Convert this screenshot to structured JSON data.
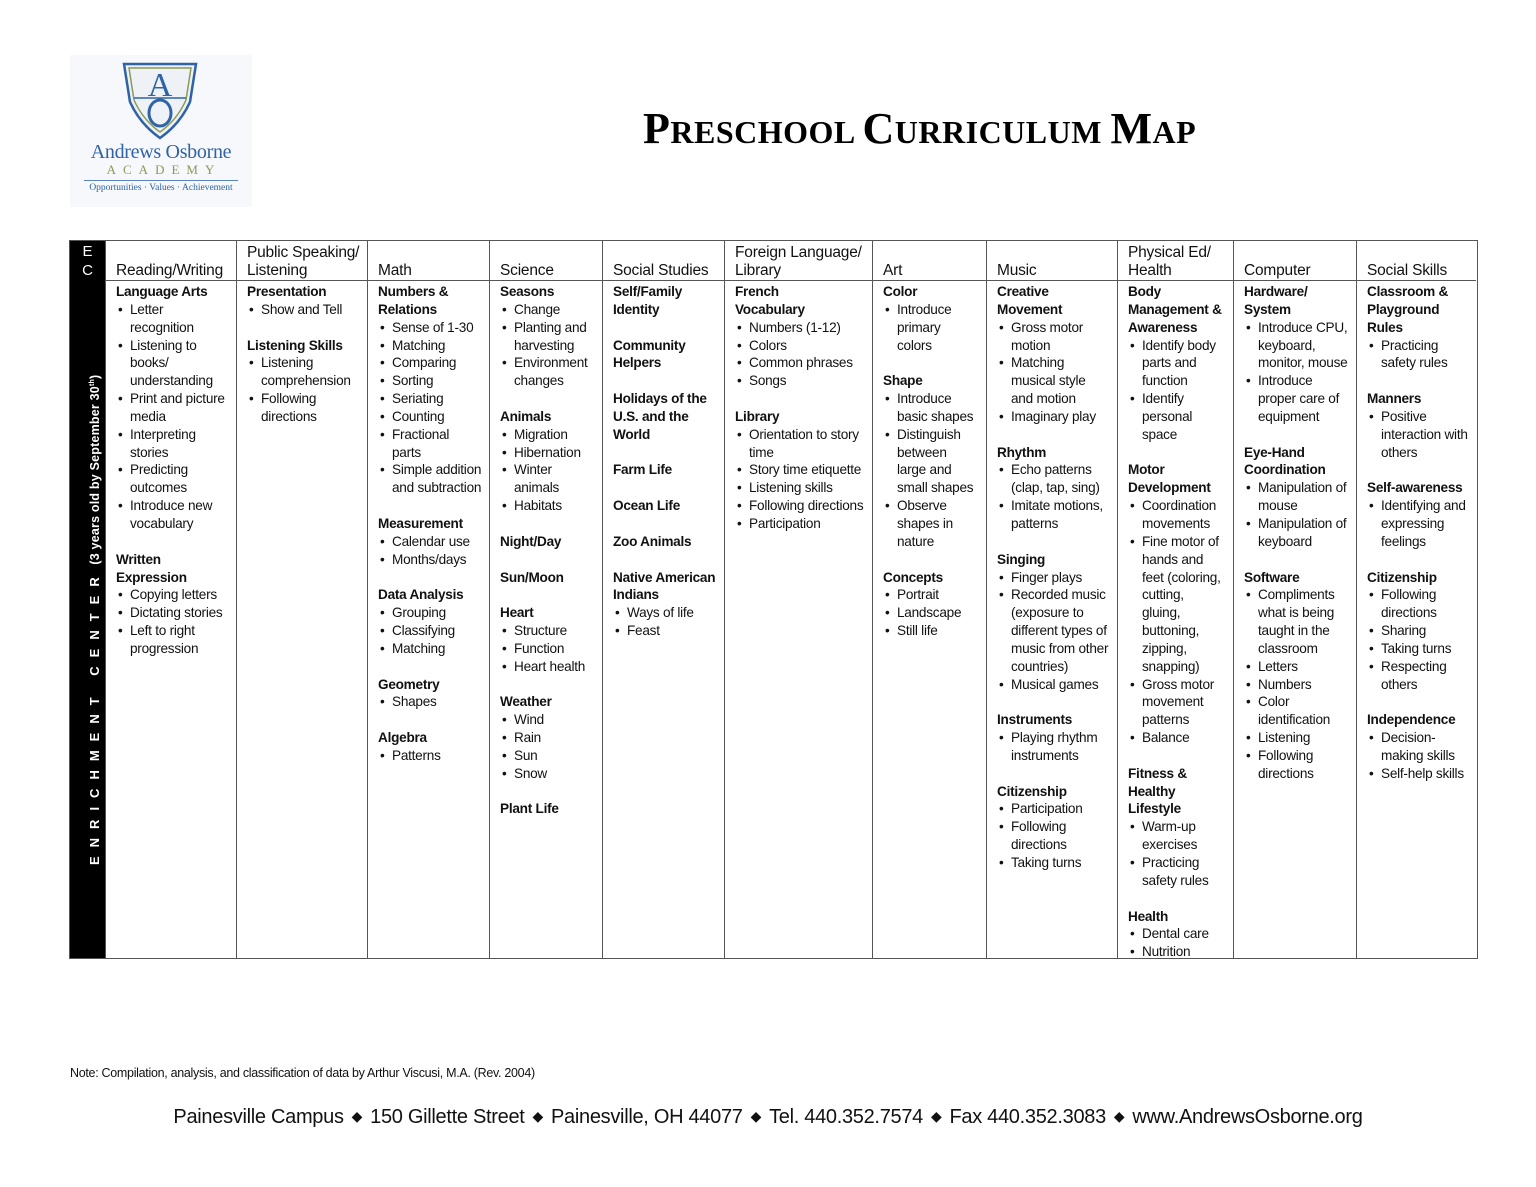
{
  "logo": {
    "monogram": "AO",
    "name": "Andrews Osborne",
    "subtitle": "ACADEMY",
    "tagline": "Opportunities · Values · Achievement",
    "colors": {
      "blue": "#2f63a5",
      "green": "#8a9a56"
    }
  },
  "title": {
    "words": [
      {
        "initial": "P",
        "rest": "RESCHOOL"
      },
      {
        "initial": "C",
        "rest": "URRICULUM"
      },
      {
        "initial": "M",
        "rest": "AP"
      }
    ]
  },
  "sidebar": {
    "corner": [
      "E",
      "C"
    ],
    "vertical_label": "ENRICHMENT CENTER",
    "age_note": "(3 years old by September 30",
    "age_sup": "th",
    "age_close": ")"
  },
  "columns": [
    {
      "header": [
        "",
        "Reading/Writing"
      ],
      "sections": [
        {
          "title": [
            "Language Arts"
          ],
          "items": [
            [
              "Letter",
              "recognition"
            ],
            [
              "Listening to",
              "books/",
              "understanding"
            ],
            [
              "Print and picture",
              "media"
            ],
            [
              "Interpreting",
              "stories"
            ],
            [
              "Predicting",
              "outcomes"
            ],
            [
              "Introduce new",
              "vocabulary"
            ]
          ]
        },
        {
          "title": [
            "Written",
            "Expression"
          ],
          "items": [
            [
              "Copying letters"
            ],
            [
              "Dictating stories"
            ],
            [
              "Left to right",
              "progression"
            ]
          ]
        }
      ]
    },
    {
      "header": [
        "Public Speaking/",
        "Listening"
      ],
      "sections": [
        {
          "title": [
            "Presentation"
          ],
          "items": [
            [
              "Show and Tell"
            ]
          ]
        },
        {
          "title": [
            "Listening Skills"
          ],
          "items": [
            [
              "Listening",
              "comprehension"
            ],
            [
              "Following",
              "directions"
            ]
          ]
        }
      ]
    },
    {
      "header": [
        "",
        "Math"
      ],
      "sections": [
        {
          "title": [
            "Numbers &",
            "Relations"
          ],
          "items": [
            [
              "Sense of 1-30"
            ],
            [
              "Matching"
            ],
            [
              "Comparing"
            ],
            [
              "Sorting"
            ],
            [
              "Seriating"
            ],
            [
              "Counting"
            ],
            [
              "Fractional",
              "parts"
            ],
            [
              "Simple addition",
              "and subtraction"
            ]
          ]
        },
        {
          "title": [
            "Measurement"
          ],
          "items": [
            [
              "Calendar use"
            ],
            [
              "Months/days"
            ]
          ]
        },
        {
          "title": [
            "Data Analysis"
          ],
          "items": [
            [
              "Grouping"
            ],
            [
              "Classifying"
            ],
            [
              "Matching"
            ]
          ]
        },
        {
          "title": [
            "Geometry"
          ],
          "items": [
            [
              "Shapes"
            ]
          ]
        },
        {
          "title": [
            "Algebra"
          ],
          "items": [
            [
              "Patterns"
            ]
          ]
        }
      ]
    },
    {
      "header": [
        "",
        "Science"
      ],
      "sections": [
        {
          "title": [
            "Seasons"
          ],
          "items": [
            [
              "Change"
            ],
            [
              "Planting and",
              "harvesting"
            ],
            [
              "Environment",
              "changes"
            ]
          ]
        },
        {
          "title": [
            "Animals"
          ],
          "items": [
            [
              "Migration"
            ],
            [
              "Hibernation"
            ],
            [
              "Winter",
              "animals"
            ],
            [
              "Habitats"
            ]
          ]
        },
        {
          "title": [
            "Night/Day"
          ],
          "items": []
        },
        {
          "title": [
            "Sun/Moon"
          ],
          "items": []
        },
        {
          "title": [
            "Heart"
          ],
          "items": [
            [
              "Structure"
            ],
            [
              "Function"
            ],
            [
              "Heart health"
            ]
          ]
        },
        {
          "title": [
            "Weather"
          ],
          "items": [
            [
              "Wind"
            ],
            [
              "Rain"
            ],
            [
              "Sun"
            ],
            [
              "Snow"
            ]
          ]
        },
        {
          "title": [
            "Plant Life"
          ],
          "items": []
        }
      ]
    },
    {
      "header": [
        "",
        "Social Studies"
      ],
      "sections": [
        {
          "title": [
            "Self/Family",
            "Identity"
          ],
          "items": []
        },
        {
          "title": [
            "Community",
            "Helpers"
          ],
          "items": []
        },
        {
          "title": [
            "Holidays of the",
            "U.S. and the",
            "World"
          ],
          "items": []
        },
        {
          "title": [
            "Farm Life"
          ],
          "items": []
        },
        {
          "title": [
            "Ocean Life"
          ],
          "items": []
        },
        {
          "title": [
            "Zoo Animals"
          ],
          "items": []
        },
        {
          "title": [
            "Native American",
            "Indians"
          ],
          "items": [
            [
              "Ways of life"
            ],
            [
              "Feast"
            ]
          ]
        }
      ]
    },
    {
      "header": [
        "Foreign Language/",
        "Library"
      ],
      "sections": [
        {
          "title": [
            "French",
            "Vocabulary"
          ],
          "items": [
            [
              "Numbers (1-12)"
            ],
            [
              "Colors"
            ],
            [
              "Common phrases"
            ],
            [
              "Songs"
            ]
          ]
        },
        {
          "title": [
            "Library"
          ],
          "items": [
            [
              "Orientation to story",
              "time"
            ],
            [
              "Story time etiquette"
            ],
            [
              "Listening skills"
            ],
            [
              "Following directions"
            ],
            [
              "Participation"
            ]
          ]
        }
      ]
    },
    {
      "header": [
        "",
        "Art"
      ],
      "sections": [
        {
          "title": [
            "Color"
          ],
          "items": [
            [
              "Introduce",
              "primary",
              "colors"
            ]
          ]
        },
        {
          "title": [
            "Shape"
          ],
          "items": [
            [
              "Introduce",
              "basic shapes"
            ],
            [
              "Distinguish",
              "between",
              "large and",
              "small shapes"
            ],
            [
              "Observe",
              "shapes in",
              "nature"
            ]
          ]
        },
        {
          "title": [
            "Concepts"
          ],
          "items": [
            [
              "Portrait"
            ],
            [
              "Landscape"
            ],
            [
              "Still life"
            ]
          ]
        }
      ]
    },
    {
      "header": [
        "",
        "Music"
      ],
      "sections": [
        {
          "title": [
            "Creative",
            "Movement"
          ],
          "items": [
            [
              "Gross motor",
              "motion"
            ],
            [
              "Matching",
              "musical style",
              "and motion"
            ],
            [
              "Imaginary play"
            ]
          ]
        },
        {
          "title": [
            "Rhythm"
          ],
          "items": [
            [
              "Echo patterns",
              "(clap, tap, sing)"
            ],
            [
              "Imitate motions,",
              "patterns"
            ]
          ]
        },
        {
          "title": [
            "Singing"
          ],
          "items": [
            [
              "Finger plays"
            ],
            [
              "Recorded music",
              "(exposure to",
              "different types of",
              "music from other",
              "countries)"
            ],
            [
              "Musical games"
            ]
          ]
        },
        {
          "title": [
            "Instruments"
          ],
          "items": [
            [
              "Playing rhythm",
              "instruments"
            ]
          ]
        },
        {
          "title": [
            "Citizenship"
          ],
          "items": [
            [
              "Participation"
            ],
            [
              "Following",
              "directions"
            ],
            [
              "Taking turns"
            ]
          ]
        }
      ]
    },
    {
      "header": [
        "Physical Ed/",
        "Health"
      ],
      "sections": [
        {
          "title": [
            "Body",
            "Management &",
            "Awareness"
          ],
          "items": [
            [
              "Identify body",
              "parts and",
              "function"
            ],
            [
              "Identify",
              "personal",
              "space"
            ]
          ]
        },
        {
          "title": [
            "Motor",
            "Development"
          ],
          "items": [
            [
              "Coordination",
              "movements"
            ],
            [
              "Fine motor of",
              "hands and",
              "feet (coloring,",
              "cutting,",
              "gluing,",
              "buttoning,",
              "zipping,",
              "snapping)"
            ],
            [
              "Gross motor",
              "movement",
              "patterns"
            ],
            [
              "Balance"
            ]
          ]
        },
        {
          "title": [
            "Fitness &",
            "Healthy",
            "Lifestyle"
          ],
          "items": [
            [
              "Warm-up",
              "exercises"
            ],
            [
              "Practicing",
              "safety rules"
            ]
          ]
        },
        {
          "title": [
            "Health"
          ],
          "items": [
            [
              "Dental care"
            ],
            [
              "Nutrition"
            ]
          ]
        }
      ]
    },
    {
      "header": [
        "",
        "Computer"
      ],
      "sections": [
        {
          "title": [
            "Hardware/",
            "System"
          ],
          "items": [
            [
              "Introduce CPU,",
              "keyboard,",
              "monitor, mouse"
            ],
            [
              "Introduce",
              "proper care of",
              "equipment"
            ]
          ]
        },
        {
          "title": [
            "Eye-Hand",
            "Coordination"
          ],
          "items": [
            [
              "Manipulation of",
              "mouse"
            ],
            [
              "Manipulation of",
              "keyboard"
            ]
          ]
        },
        {
          "title": [
            "Software"
          ],
          "items": [
            [
              "Compliments",
              "what is being",
              "taught in the",
              "classroom"
            ],
            [
              "Letters"
            ],
            [
              "Numbers"
            ],
            [
              "Color",
              "identification"
            ],
            [
              "Listening"
            ],
            [
              "Following",
              "directions"
            ]
          ]
        }
      ]
    },
    {
      "header": [
        "",
        "Social Skills"
      ],
      "sections": [
        {
          "title": [
            "Classroom &",
            "Playground",
            "Rules"
          ],
          "items": [
            [
              "Practicing",
              "safety rules"
            ]
          ]
        },
        {
          "title": [
            "Manners"
          ],
          "items": [
            [
              "Positive",
              "interaction with",
              "others"
            ]
          ]
        },
        {
          "title": [
            "Self-awareness"
          ],
          "items": [
            [
              "Identifying and",
              "expressing",
              "feelings"
            ]
          ]
        },
        {
          "title": [
            "Citizenship"
          ],
          "items": [
            [
              "Following",
              "directions"
            ],
            [
              "Sharing"
            ],
            [
              "Taking turns"
            ],
            [
              "Respecting",
              "others"
            ]
          ]
        },
        {
          "title": [
            "Independence"
          ],
          "items": [
            [
              "Decision-",
              "making skills"
            ],
            [
              "Self-help skills"
            ]
          ]
        }
      ]
    }
  ],
  "footer": {
    "note": "Note: Compilation, analysis, and classification of data by Arthur Viscusi, M.A. (Rev. 2004)",
    "address_parts": [
      "Painesville Campus",
      "150 Gillette Street",
      "Painesville, OH 44077",
      "Tel. 440.352.7574",
      "Fax 440.352.3083",
      "www.AndrewsOsborne.org"
    ],
    "separator_icon": "diamond"
  }
}
